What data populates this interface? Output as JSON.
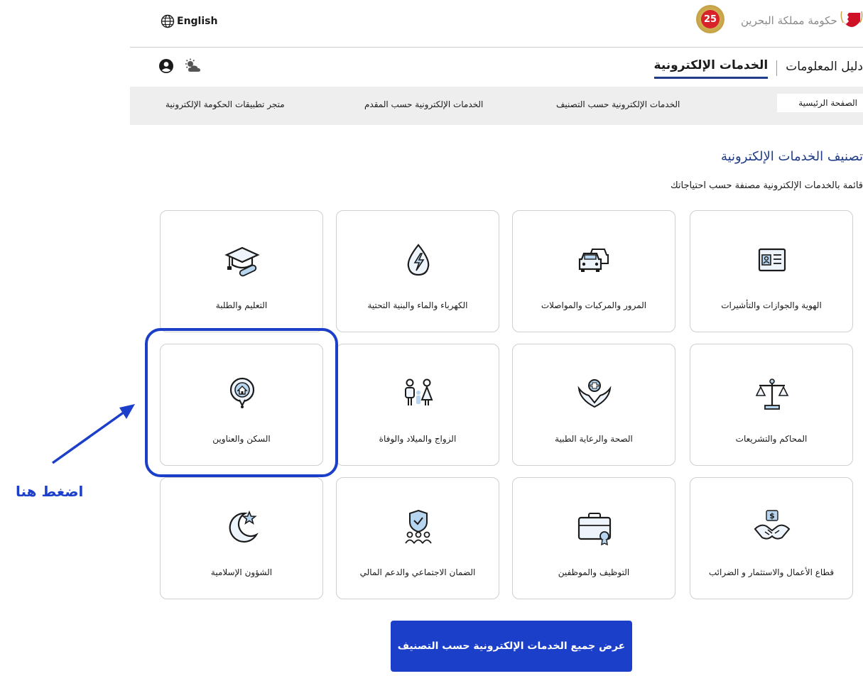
{
  "header": {
    "language_link": "English",
    "logo_number": "25",
    "gov_name": "حكومة مملكة البحرين"
  },
  "nav": {
    "tabs": [
      {
        "label": "دليل المعلومات"
      },
      {
        "label": "الخدمات الإلكترونية"
      }
    ]
  },
  "subnav": {
    "items": [
      {
        "label": "الصفحة الرئيسية"
      },
      {
        "label": "الخدمات الإلكترونية حسب التصنيف"
      },
      {
        "label": "الخدمات الإلكترونية حسب المقدم"
      },
      {
        "label": "متجر تطبيقات الحكومة الإلكترونية"
      }
    ]
  },
  "main": {
    "title": "تصنيف الخدمات الإلكترونية",
    "subtitle": "قائمة بالخدمات الإلكترونية مصنفة حسب احتياجاتك",
    "cards": [
      {
        "label": "الهوية والجوازات والتأشيرات",
        "icon": "id-card-icon"
      },
      {
        "label": "المرور والمركبات والمواصلات",
        "icon": "cars-icon"
      },
      {
        "label": "الكهرباء والماء والبنية التحتية",
        "icon": "water-electricity-icon"
      },
      {
        "label": "التعليم والطلبة",
        "icon": "graduation-cap-icon"
      },
      {
        "label": "المحاكم والتشريعات",
        "icon": "scales-icon"
      },
      {
        "label": "الصحة والرعاية الطبية",
        "icon": "health-care-icon"
      },
      {
        "label": "الزواج والميلاد والوفاة",
        "icon": "family-icon"
      },
      {
        "label": "السكن والعناوين",
        "icon": "home-pin-icon"
      },
      {
        "label": "قطاع الأعمال والاستثمار و الضرائب",
        "icon": "business-handshake-icon"
      },
      {
        "label": "التوظيف والموظفين",
        "icon": "briefcase-icon"
      },
      {
        "label": "الضمان الاجتماعي والدعم المالي",
        "icon": "social-security-icon"
      },
      {
        "label": "الشؤون الإسلامية",
        "icon": "crescent-star-icon"
      }
    ],
    "cta_label": "عرض جميع الخدمات الإلكترونية حسب التصنيف"
  },
  "annotation": {
    "text": "اضغط هنا",
    "color": "#1c3fc9"
  }
}
